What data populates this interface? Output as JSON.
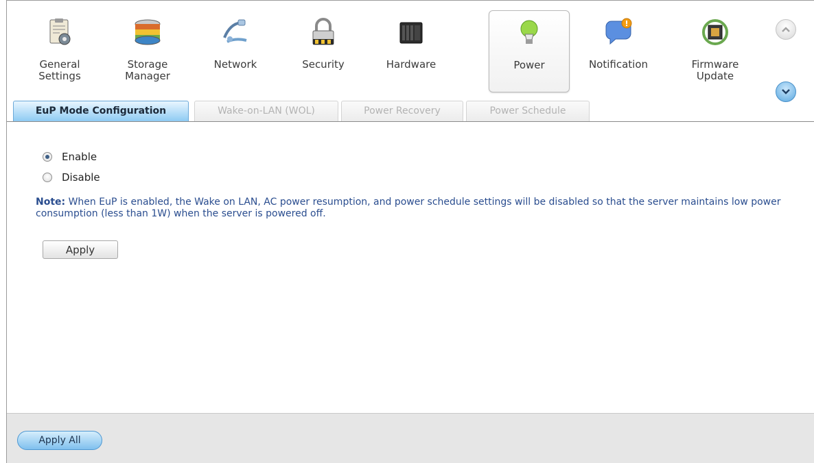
{
  "toolbar": {
    "items": [
      {
        "label": "General\nSettings",
        "icon": "clipboard-gear-icon"
      },
      {
        "label": "Storage\nManager",
        "icon": "disk-stack-icon"
      },
      {
        "label": "Network",
        "icon": "network-plug-icon"
      },
      {
        "label": "Security",
        "icon": "padlock-icon"
      },
      {
        "label": "Hardware",
        "icon": "server-box-icon"
      },
      {
        "label": "Power",
        "icon": "lightbulb-icon",
        "active": true
      },
      {
        "label": "Notification",
        "icon": "speech-bubble-alert-icon"
      },
      {
        "label": "Firmware\nUpdate",
        "icon": "chip-refresh-icon"
      }
    ],
    "scroll_up": "chevron-up-icon",
    "scroll_down": "chevron-down-icon"
  },
  "tabs": [
    {
      "label": "EuP Mode Configuration",
      "active": true
    },
    {
      "label": "Wake-on-LAN (WOL)",
      "active": false
    },
    {
      "label": "Power Recovery",
      "active": false
    },
    {
      "label": "Power Schedule",
      "active": false
    }
  ],
  "eup": {
    "options": [
      {
        "label": "Enable",
        "checked": true
      },
      {
        "label": "Disable",
        "checked": false
      }
    ],
    "note_prefix": "Note:",
    "note_text": " When EuP is enabled, the Wake on LAN, AC power resumption, and power schedule settings will be disabled so that the server maintains low power consumption (less than 1W) when the server is powered off.",
    "apply_label": "Apply"
  },
  "footer": {
    "apply_all_label": "Apply All"
  },
  "colors": {
    "active_tab": "#8ecbf3",
    "note_text": "#2a4d8f",
    "footer_bg": "#e6e6e6"
  }
}
